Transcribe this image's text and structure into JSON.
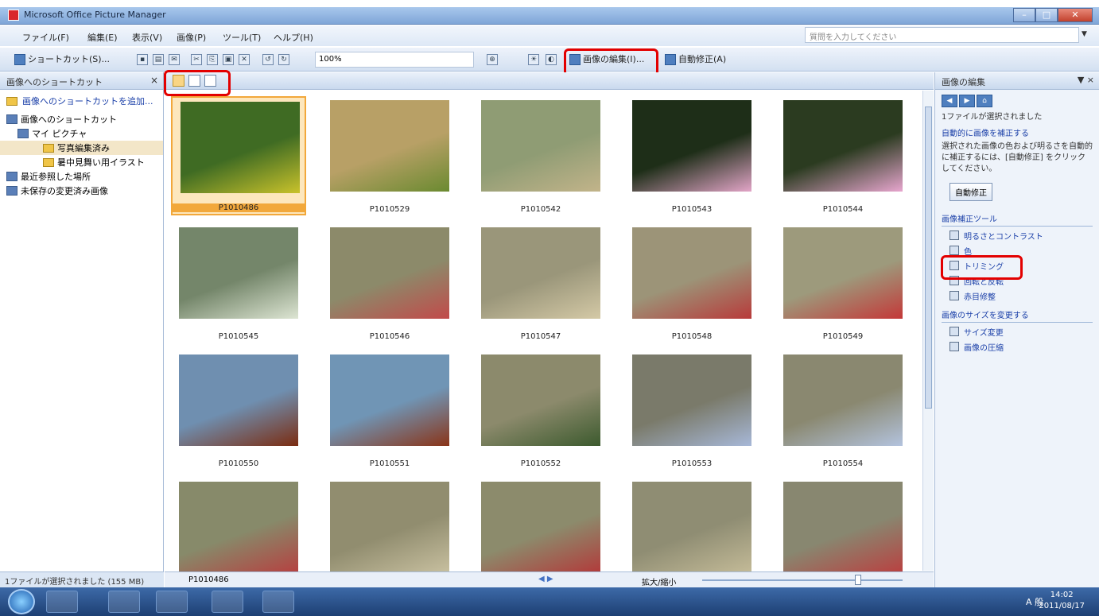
{
  "window": {
    "title": "Microsoft Office Picture Manager"
  },
  "menu": [
    "ファイル(F)",
    "編集(E)",
    "表示(V)",
    "画像(P)",
    "ツール(T)",
    "ヘルプ(H)"
  ],
  "help_search": {
    "placeholder": "質問を入力してください"
  },
  "toolbar": {
    "shortcut_label": "ショートカット(S)...",
    "zoom_value": "100%",
    "edit_picture_label": "画像の編集(I)...",
    "auto_correct_label": "自動修正(A)"
  },
  "left_pane": {
    "title": "画像へのショートカット",
    "add_link": "画像へのショートカットを追加...",
    "tree": [
      {
        "label": "画像へのショートカット",
        "level": 0,
        "selected": false
      },
      {
        "label": "マイ ピクチャ",
        "level": 1,
        "selected": false
      },
      {
        "label": "写真編集済み",
        "level": 2,
        "selected": true
      },
      {
        "label": "暑中見舞い用イラスト",
        "level": 2,
        "selected": false
      },
      {
        "label": "最近参照した場所",
        "level": 0,
        "selected": false
      },
      {
        "label": "未保存の変更済み画像",
        "level": 0,
        "selected": false
      }
    ],
    "status": "1ファイルが選択されました (155 MB)"
  },
  "thumbnails": [
    {
      "label": "P1010486",
      "selected": true,
      "colors": [
        "#3f6b23",
        "#c9c22b"
      ]
    },
    {
      "label": "P1010529",
      "selected": false,
      "colors": [
        "#b8a066",
        "#6a8a30"
      ]
    },
    {
      "label": "P1010542",
      "selected": false,
      "colors": [
        "#8f9c74",
        "#c2b48a"
      ]
    },
    {
      "label": "P1010543",
      "selected": false,
      "colors": [
        "#1e2e18",
        "#e3a5c8"
      ]
    },
    {
      "label": "P1010544",
      "selected": false,
      "colors": [
        "#2b3b20",
        "#e8a6cf"
      ]
    },
    {
      "label": "P1010545",
      "selected": false,
      "colors": [
        "#74866a",
        "#dde5d3"
      ]
    },
    {
      "label": "P1010546",
      "selected": false,
      "colors": [
        "#8c8a6a",
        "#c24a4a"
      ]
    },
    {
      "label": "P1010547",
      "selected": false,
      "colors": [
        "#9a967a",
        "#d4c9a6"
      ]
    },
    {
      "label": "P1010548",
      "selected": false,
      "colors": [
        "#9c9478",
        "#b83a3a"
      ]
    },
    {
      "label": "P1010549",
      "selected": false,
      "colors": [
        "#9d9a7c",
        "#c43838"
      ]
    },
    {
      "label": "P1010550",
      "selected": false,
      "colors": [
        "#6f8fb0",
        "#7b2c11"
      ]
    },
    {
      "label": "P1010551",
      "selected": false,
      "colors": [
        "#7095b5",
        "#8a3418"
      ]
    },
    {
      "label": "P1010552",
      "selected": false,
      "colors": [
        "#8c8a6c",
        "#3c5a2e"
      ]
    },
    {
      "label": "P1010553",
      "selected": false,
      "colors": [
        "#7a7a6a",
        "#a7b8d8"
      ]
    },
    {
      "label": "P1010554",
      "selected": false,
      "colors": [
        "#8a8870",
        "#b3c3de"
      ]
    },
    {
      "label": "",
      "selected": false,
      "colors": [
        "#878a6a",
        "#b64040"
      ]
    },
    {
      "label": "",
      "selected": false,
      "colors": [
        "#918d6f",
        "#c8c0a0"
      ]
    },
    {
      "label": "",
      "selected": false,
      "colors": [
        "#8c8b6c",
        "#b23a3a"
      ]
    },
    {
      "label": "",
      "selected": false,
      "colors": [
        "#8f8d73",
        "#c4bb98"
      ]
    },
    {
      "label": "",
      "selected": false,
      "colors": [
        "#888770",
        "#ba4040"
      ]
    }
  ],
  "bottom_bar": {
    "filename": "P1010486",
    "zoom_label": "拡大/縮小"
  },
  "right_pane": {
    "title": "画像の編集",
    "selected_text": "1ファイルが選択されました",
    "auto_link": "自動的に画像を補正する",
    "instruction": "選択された画像の色および明るさを自動的に補正するには、[自動修正] をクリックしてください。",
    "auto_button": "自動修正",
    "section_tools": "画像補正ツール",
    "tools": [
      "明るさとコントラスト",
      "色",
      "トリミング",
      "回転と反転",
      "赤目修整"
    ],
    "section_size": "画像のサイズを変更する",
    "size_tools": [
      "サイズ変更",
      "画像の圧縮"
    ]
  },
  "taskbar": {
    "time": "14:02",
    "date": "2011/08/17",
    "tray": "A 般"
  }
}
